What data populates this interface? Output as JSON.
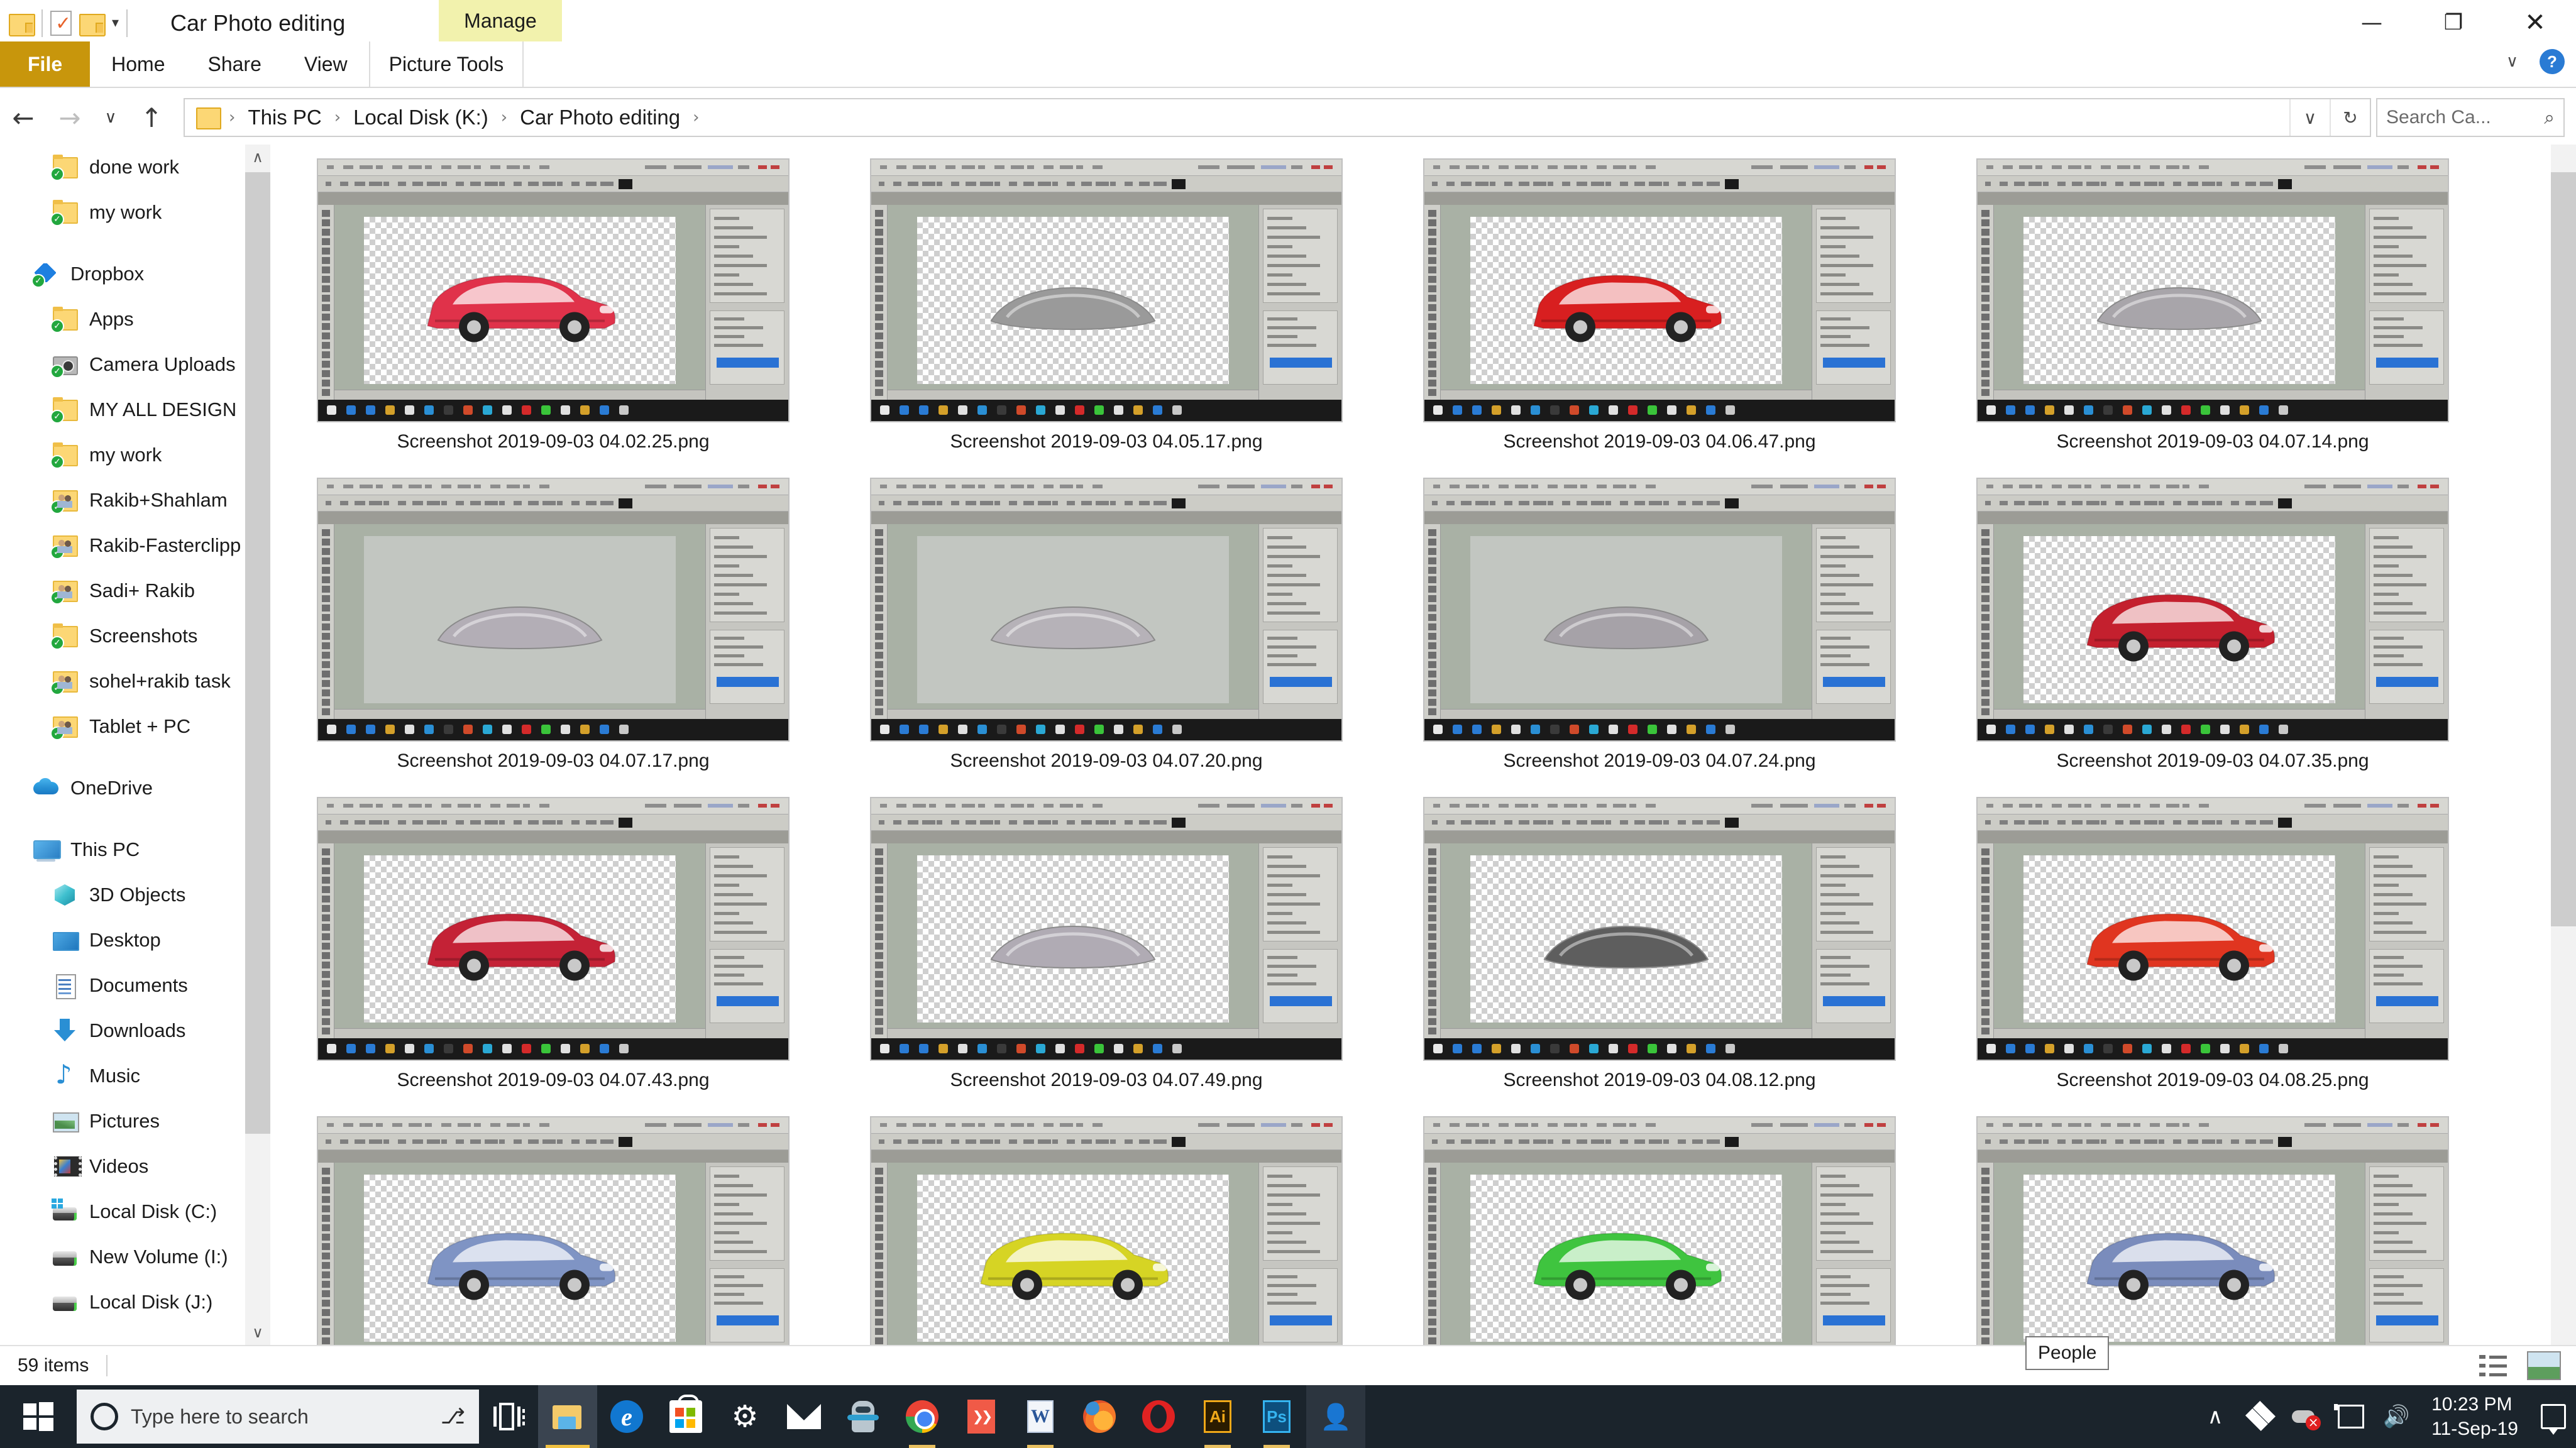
{
  "window": {
    "title": "Car Photo editing",
    "contextual_tab_group": "Manage",
    "minimize": "—",
    "maximize": "❐",
    "close": "✕",
    "qat_caret": "▾"
  },
  "ribbon": {
    "tabs": [
      {
        "label": "File",
        "type": "file"
      },
      {
        "label": "Home",
        "type": "normal"
      },
      {
        "label": "Share",
        "type": "normal"
      },
      {
        "label": "View",
        "type": "normal"
      },
      {
        "label": "Picture Tools",
        "type": "contextual"
      }
    ],
    "collapse_caret": "∨",
    "help_label": "?"
  },
  "address": {
    "back": "←",
    "forward": "→",
    "recent_caret": "∨",
    "up": "↑",
    "breadcrumbs": [
      "This PC",
      "Local Disk (K:)",
      "Car Photo editing"
    ],
    "separator": "›",
    "trailing_separator": "›",
    "history_caret": "∨",
    "refresh": "↻"
  },
  "search": {
    "placeholder": "Search Ca...",
    "icon": "⌕"
  },
  "sidebar": {
    "scroll_up": "∧",
    "scroll_down": "∨",
    "items": [
      {
        "label": "done work",
        "icon": "folder",
        "level": 2,
        "synced": true
      },
      {
        "label": "my work",
        "icon": "folder",
        "level": 2,
        "synced": true
      },
      {
        "label": "Dropbox",
        "icon": "dropbox",
        "level": 1,
        "synced": true
      },
      {
        "label": "Apps",
        "icon": "folder",
        "level": 2,
        "synced": true
      },
      {
        "label": "Camera Uploads",
        "icon": "camera",
        "level": 2,
        "synced": true
      },
      {
        "label": "MY ALL DESIGN",
        "icon": "folder",
        "level": 2,
        "synced": true
      },
      {
        "label": "my work",
        "icon": "folder",
        "level": 2,
        "synced": true
      },
      {
        "label": "Rakib+Shahlam",
        "icon": "shared-folder",
        "level": 2,
        "synced": true
      },
      {
        "label": "Rakib-Fasterclipp",
        "icon": "shared-folder",
        "level": 2,
        "synced": true
      },
      {
        "label": "Sadi+ Rakib",
        "icon": "shared-folder",
        "level": 2,
        "synced": true
      },
      {
        "label": "Screenshots",
        "icon": "folder",
        "level": 2,
        "synced": true
      },
      {
        "label": "sohel+rakib task",
        "icon": "shared-folder",
        "level": 2,
        "synced": true
      },
      {
        "label": "Tablet + PC",
        "icon": "shared-folder",
        "level": 2,
        "synced": true
      },
      {
        "label": "OneDrive",
        "icon": "onedrive",
        "level": 1,
        "synced": false
      },
      {
        "label": "This PC",
        "icon": "pc",
        "level": 1,
        "synced": false
      },
      {
        "label": "3D Objects",
        "icon": "3d",
        "level": 2,
        "synced": false
      },
      {
        "label": "Desktop",
        "icon": "desktop",
        "level": 2,
        "synced": false
      },
      {
        "label": "Documents",
        "icon": "documents",
        "level": 2,
        "synced": false
      },
      {
        "label": "Downloads",
        "icon": "downloads",
        "level": 2,
        "synced": false
      },
      {
        "label": "Music",
        "icon": "music",
        "level": 2,
        "synced": false
      },
      {
        "label": "Pictures",
        "icon": "pictures",
        "level": 2,
        "synced": false
      },
      {
        "label": "Videos",
        "icon": "videos",
        "level": 2,
        "synced": false
      },
      {
        "label": "Local Disk (C:)",
        "icon": "drive-windows",
        "level": 2,
        "synced": false
      },
      {
        "label": "New Volume (I:)",
        "icon": "drive",
        "level": 2,
        "synced": false
      },
      {
        "label": "Local Disk (J:)",
        "icon": "drive",
        "level": 2,
        "synced": false
      }
    ]
  },
  "files": [
    {
      "name": "Screenshot 2019-09-03 04.02.25.png",
      "subject": "red hatchback car",
      "color": "#e0324a",
      "transparent": true
    },
    {
      "name": "Screenshot 2019-09-03 04.05.17.png",
      "subject": "grey car spoiler",
      "color": "#9a9a9a",
      "transparent": true
    },
    {
      "name": "Screenshot 2019-09-03 04.06.47.png",
      "subject": "red sports car",
      "color": "#d81f20",
      "transparent": true
    },
    {
      "name": "Screenshot 2019-09-03 04.07.14.png",
      "subject": "grey car hood",
      "color": "#a8a5aa",
      "transparent": true
    },
    {
      "name": "Screenshot 2019-09-03 04.07.17.png",
      "subject": "grey car bonnet vents",
      "color": "#b3aeb6",
      "transparent": false
    },
    {
      "name": "Screenshot 2019-09-03 04.07.20.png",
      "subject": "grey front bumper",
      "color": "#b6b2b8",
      "transparent": false
    },
    {
      "name": "Screenshot 2019-09-03 04.07.24.png",
      "subject": "grey car hood panel",
      "color": "#a6a2a8",
      "transparent": false
    },
    {
      "name": "Screenshot 2019-09-03 04.07.35.png",
      "subject": "red convertible sports car",
      "color": "#c4202e",
      "transparent": true
    },
    {
      "name": "Screenshot 2019-09-03 04.07.43.png",
      "subject": "red sports car front view",
      "color": "#c42236",
      "transparent": true
    },
    {
      "name": "Screenshot 2019-09-03 04.07.49.png",
      "subject": "grey car roof panel",
      "color": "#b0abb4",
      "transparent": true
    },
    {
      "name": "Screenshot 2019-09-03 04.08.12.png",
      "subject": "dark grey spoiler",
      "color": "#5e5e5e",
      "transparent": true
    },
    {
      "name": "Screenshot 2019-09-03 04.08.25.png",
      "subject": "red sedan car",
      "color": "#e03520",
      "transparent": true
    },
    {
      "name": "",
      "subject": "blue hatchback car",
      "color": "#7f94c4",
      "transparent": true
    },
    {
      "name": "",
      "subject": "yellow coupe car",
      "color": "#d6d424",
      "transparent": true
    },
    {
      "name": "",
      "subject": "green hatchback rear",
      "color": "#3fc43f",
      "transparent": true
    },
    {
      "name": "",
      "subject": "blue sedan rear",
      "color": "#7a8cbc",
      "transparent": true
    }
  ],
  "statusbar": {
    "item_count": "59 items",
    "details_view_icon": "details-view-icon",
    "large_icons_view_icon": "large-icons-view-icon"
  },
  "tooltip": {
    "text": "People"
  },
  "taskbar": {
    "start_label": "Start",
    "search_placeholder": "Type here to search",
    "mic_icon": "ơ",
    "apps": [
      {
        "name": "task-view",
        "label": "Task View"
      },
      {
        "name": "file-explorer",
        "label": "File Explorer"
      },
      {
        "name": "microsoft-edge",
        "label": "Microsoft Edge"
      },
      {
        "name": "microsoft-store",
        "label": "Microsoft Store"
      },
      {
        "name": "settings",
        "label": "Settings"
      },
      {
        "name": "mail",
        "label": "Mail"
      },
      {
        "name": "robot-app",
        "label": "Robot"
      },
      {
        "name": "google-chrome",
        "label": "Google Chrome"
      },
      {
        "name": "diamond-app",
        "label": "Diamond App"
      },
      {
        "name": "microsoft-word",
        "label": "Word"
      },
      {
        "name": "mozilla-firefox",
        "label": "Firefox"
      },
      {
        "name": "opera",
        "label": "Opera"
      },
      {
        "name": "adobe-illustrator",
        "label": "Ai"
      },
      {
        "name": "adobe-photoshop",
        "label": "Ps"
      },
      {
        "name": "people",
        "label": "People"
      }
    ],
    "tray": {
      "show_hidden": "∧",
      "dropbox": "dropbox-tray-icon",
      "onedrive_error": "onedrive-error-icon",
      "network": "network-icon",
      "volume": "ὐA",
      "time": "10:23 PM",
      "date": "11-Sep-19",
      "notifications": "action-center-icon"
    }
  }
}
